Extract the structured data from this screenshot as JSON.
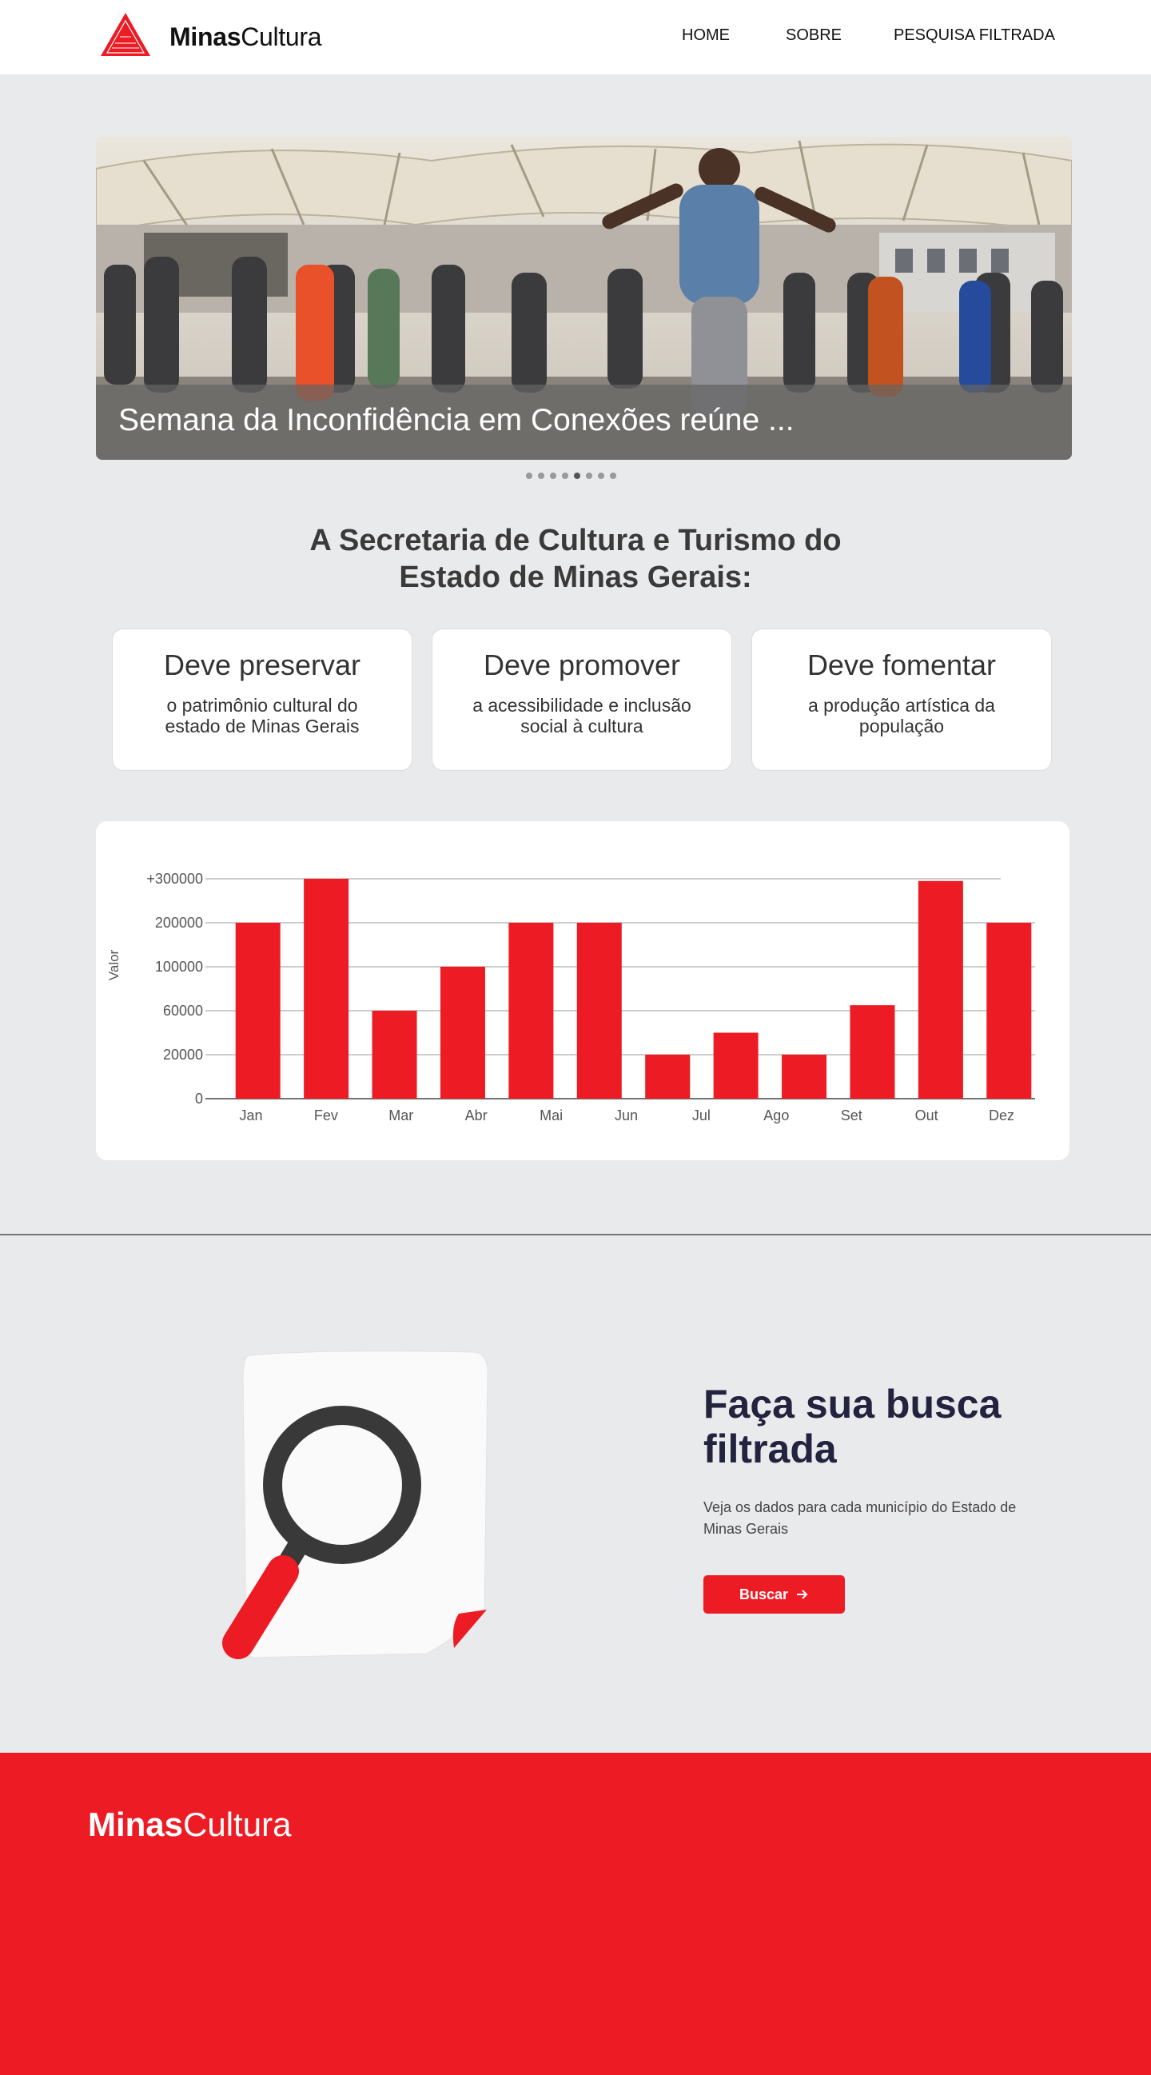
{
  "header": {
    "logo_bold": "Minas",
    "logo_light": "Cultura",
    "nav": [
      "HOME",
      "SOBRE",
      "PESQUISA FILTRADA"
    ]
  },
  "carousel": {
    "caption": "Semana da Inconfidência em Conexões reúne ...",
    "slide_count": 8,
    "active_index": 4
  },
  "mission": {
    "title_line1": "A Secretaria de Cultura e Turismo do",
    "title_line2": "Estado de Minas Gerais:",
    "cards": [
      {
        "title": "Deve preservar",
        "text": "o patrimônio cultural do estado de Minas Gerais"
      },
      {
        "title": "Deve promover",
        "text": "a acessibilidade e inclusão social à cultura"
      },
      {
        "title": "Deve fomentar",
        "text": "a produção artística da população"
      }
    ]
  },
  "chart_data": {
    "type": "bar",
    "ylabel": "Valor",
    "y_ticks": [
      "0",
      "20000",
      "60000",
      "100000",
      "200000",
      "+300000"
    ],
    "categories": [
      "Jan",
      "Fev",
      "Mar",
      "Abr",
      "Mai",
      "Jun",
      "Jul",
      "Ago",
      "Set",
      "Out",
      "Dez"
    ],
    "values": [
      200000,
      300000,
      60000,
      100000,
      200000,
      200000,
      20000,
      40000,
      20000,
      65000,
      295000,
      200000
    ],
    "bar_color": "#ed1c24",
    "grid": true
  },
  "search": {
    "title": "Faça sua busca filtrada",
    "description": "Veja os dados para cada município do Estado de Minas Gerais",
    "button_label": "Buscar",
    "button_icon": "arrow-right-icon"
  },
  "footer": {
    "logo_bold": "Minas",
    "logo_light": "Cultura"
  },
  "colors": {
    "accent": "#ed1c24",
    "background": "#e9eaec",
    "heading_dark": "#23233f"
  }
}
